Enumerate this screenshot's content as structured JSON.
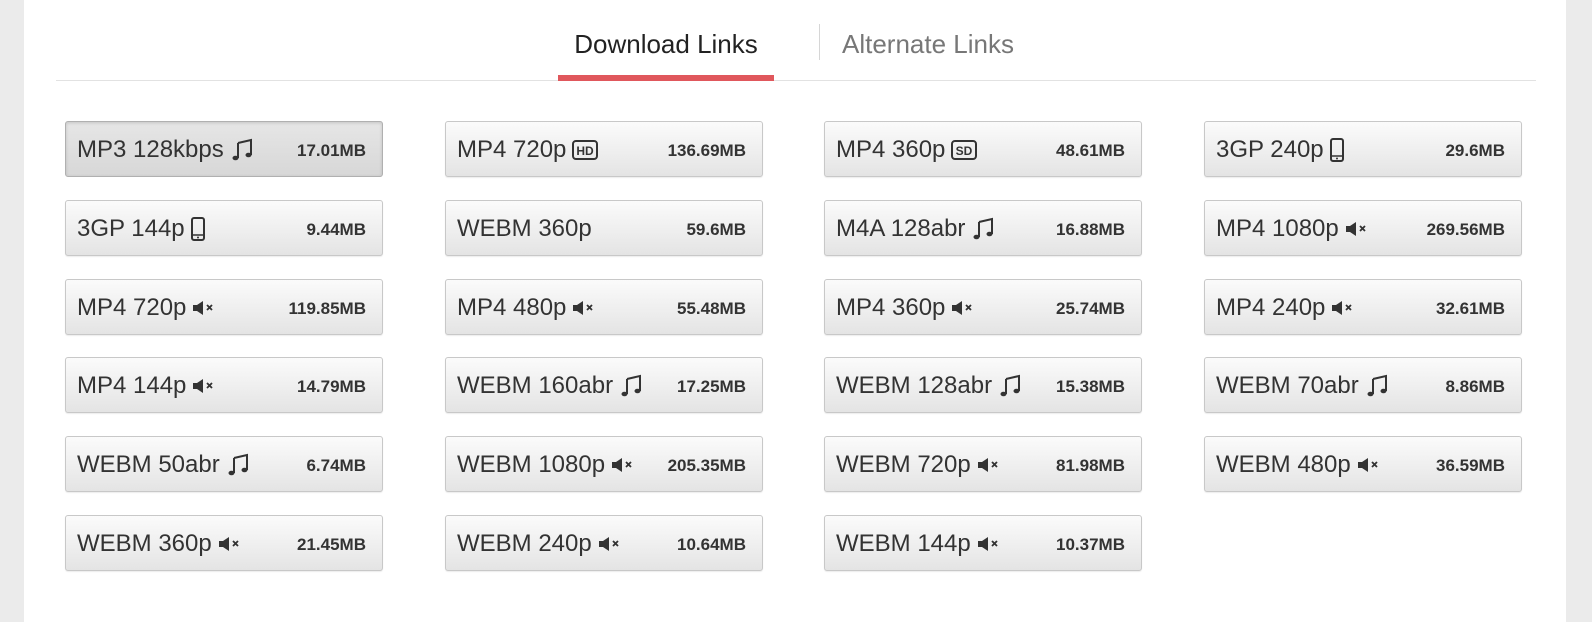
{
  "tabs": [
    {
      "label": "Download Links",
      "active": true
    },
    {
      "label": "Alternate Links",
      "active": false
    }
  ],
  "accent_color": "#e0575c",
  "links": [
    {
      "label": "MP3 128kbps",
      "icon": "music-note-icon",
      "size": "17.01MB",
      "active": true
    },
    {
      "label": "MP4 720p",
      "icon": "hd-icon",
      "size": "136.69MB"
    },
    {
      "label": "MP4 360p",
      "icon": "sd-icon",
      "size": "48.61MB"
    },
    {
      "label": "3GP 240p",
      "icon": "mobile-phone-icon",
      "size": "29.6MB"
    },
    {
      "label": "3GP 144p",
      "icon": "mobile-phone-icon",
      "size": "9.44MB"
    },
    {
      "label": "WEBM 360p",
      "icon": "",
      "size": "59.6MB"
    },
    {
      "label": "M4A 128abr",
      "icon": "music-note-icon",
      "size": "16.88MB"
    },
    {
      "label": "MP4 1080p",
      "icon": "mute-icon",
      "size": "269.56MB"
    },
    {
      "label": "MP4 720p",
      "icon": "mute-icon",
      "size": "119.85MB"
    },
    {
      "label": "MP4 480p",
      "icon": "mute-icon",
      "size": "55.48MB"
    },
    {
      "label": "MP4 360p",
      "icon": "mute-icon",
      "size": "25.74MB"
    },
    {
      "label": "MP4 240p",
      "icon": "mute-icon",
      "size": "32.61MB"
    },
    {
      "label": "MP4 144p",
      "icon": "mute-icon",
      "size": "14.79MB"
    },
    {
      "label": "WEBM 160abr",
      "icon": "music-note-icon",
      "size": "17.25MB"
    },
    {
      "label": "WEBM 128abr",
      "icon": "music-note-icon",
      "size": "15.38MB"
    },
    {
      "label": "WEBM 70abr",
      "icon": "music-note-icon",
      "size": "8.86MB"
    },
    {
      "label": "WEBM 50abr",
      "icon": "music-note-icon",
      "size": "6.74MB"
    },
    {
      "label": "WEBM 1080p",
      "icon": "mute-icon",
      "size": "205.35MB"
    },
    {
      "label": "WEBM 720p",
      "icon": "mute-icon",
      "size": "81.98MB"
    },
    {
      "label": "WEBM 480p",
      "icon": "mute-icon",
      "size": "36.59MB"
    },
    {
      "label": "WEBM 360p",
      "icon": "mute-icon",
      "size": "21.45MB"
    },
    {
      "label": "WEBM 240p",
      "icon": "mute-icon",
      "size": "10.64MB"
    },
    {
      "label": "WEBM 144p",
      "icon": "mute-icon",
      "size": "10.37MB"
    }
  ]
}
